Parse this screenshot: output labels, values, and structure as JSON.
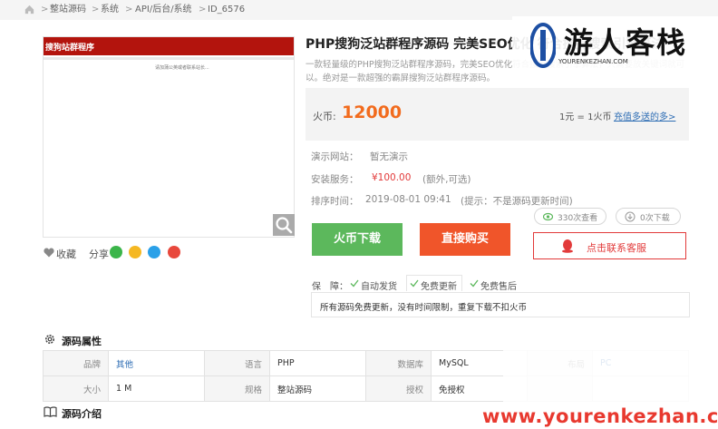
{
  "breadcrumb": {
    "items": [
      "整站源码",
      "系统",
      "API/后台/系统",
      "ID_6576"
    ],
    "separator": ">"
  },
  "preview": {
    "banner_title": "搜狗站群程序",
    "subtitle": "请加蒲公英或者联系站长..."
  },
  "actions": {
    "favorite_label": "收藏",
    "share_label": "分享"
  },
  "product": {
    "title": "PHP搜狗泛站群程序源码 完美SEO优化 符合搜狗搜索引擎算法",
    "description": "一款轻量级的PHP搜狗泛站群程序源码，完美SEO优化符合搜狗搜索引擎算法，只需要放关键词就可以。绝对是一款超强的霸屏搜狗泛站群程序源码。"
  },
  "logo": {
    "text": "游人客栈",
    "url": "YOURENKEZHAN.COM"
  },
  "price": {
    "label": "火币:",
    "value": "12000",
    "rate": "1元 = 1火币",
    "rate_link": "充值多送的多>"
  },
  "info": {
    "demo_label": "演示网站：",
    "demo_value": "暂无演示",
    "install_label": "安装服务：",
    "install_price": "¥100.00",
    "install_note": "(额外,可选)",
    "time_label": "排序时间：",
    "time_value": "2019-08-01 09:41",
    "time_note": "(提示：不是源码更新时间)"
  },
  "stats": {
    "views": "330次查看",
    "downloads": "0次下载"
  },
  "buttons": {
    "download": "火币下载",
    "buy": "直接购买",
    "contact": "点击联系客服"
  },
  "guarantee": {
    "label": "保　障：",
    "items": [
      "自动发货",
      "免费更新",
      "免费售后"
    ]
  },
  "notice": "所有源码免费更新，没有时间限制，重复下载不扣火币",
  "attributes": {
    "title": "源码属性",
    "rows": [
      [
        [
          "品牌",
          "其他"
        ],
        [
          "语言",
          "PHP"
        ],
        [
          "数据库",
          "MySQL"
        ],
        [
          "布局",
          "PC"
        ]
      ],
      [
        [
          "大小",
          "1 M"
        ],
        [
          "规格",
          "整站源码"
        ],
        [
          "授权",
          "免授权"
        ],
        [
          "",
          ""
        ]
      ]
    ]
  },
  "intro": {
    "title": "源码介绍"
  },
  "watermark": "www.yourenkezhan.com",
  "colors": {
    "accent_orange": "#f26b1d",
    "download_green": "#5cb85c",
    "buy_red": "#f0552a",
    "link_blue": "#2e6db4",
    "banner_red": "#b3140d",
    "watermark_red": "#e8392f"
  }
}
